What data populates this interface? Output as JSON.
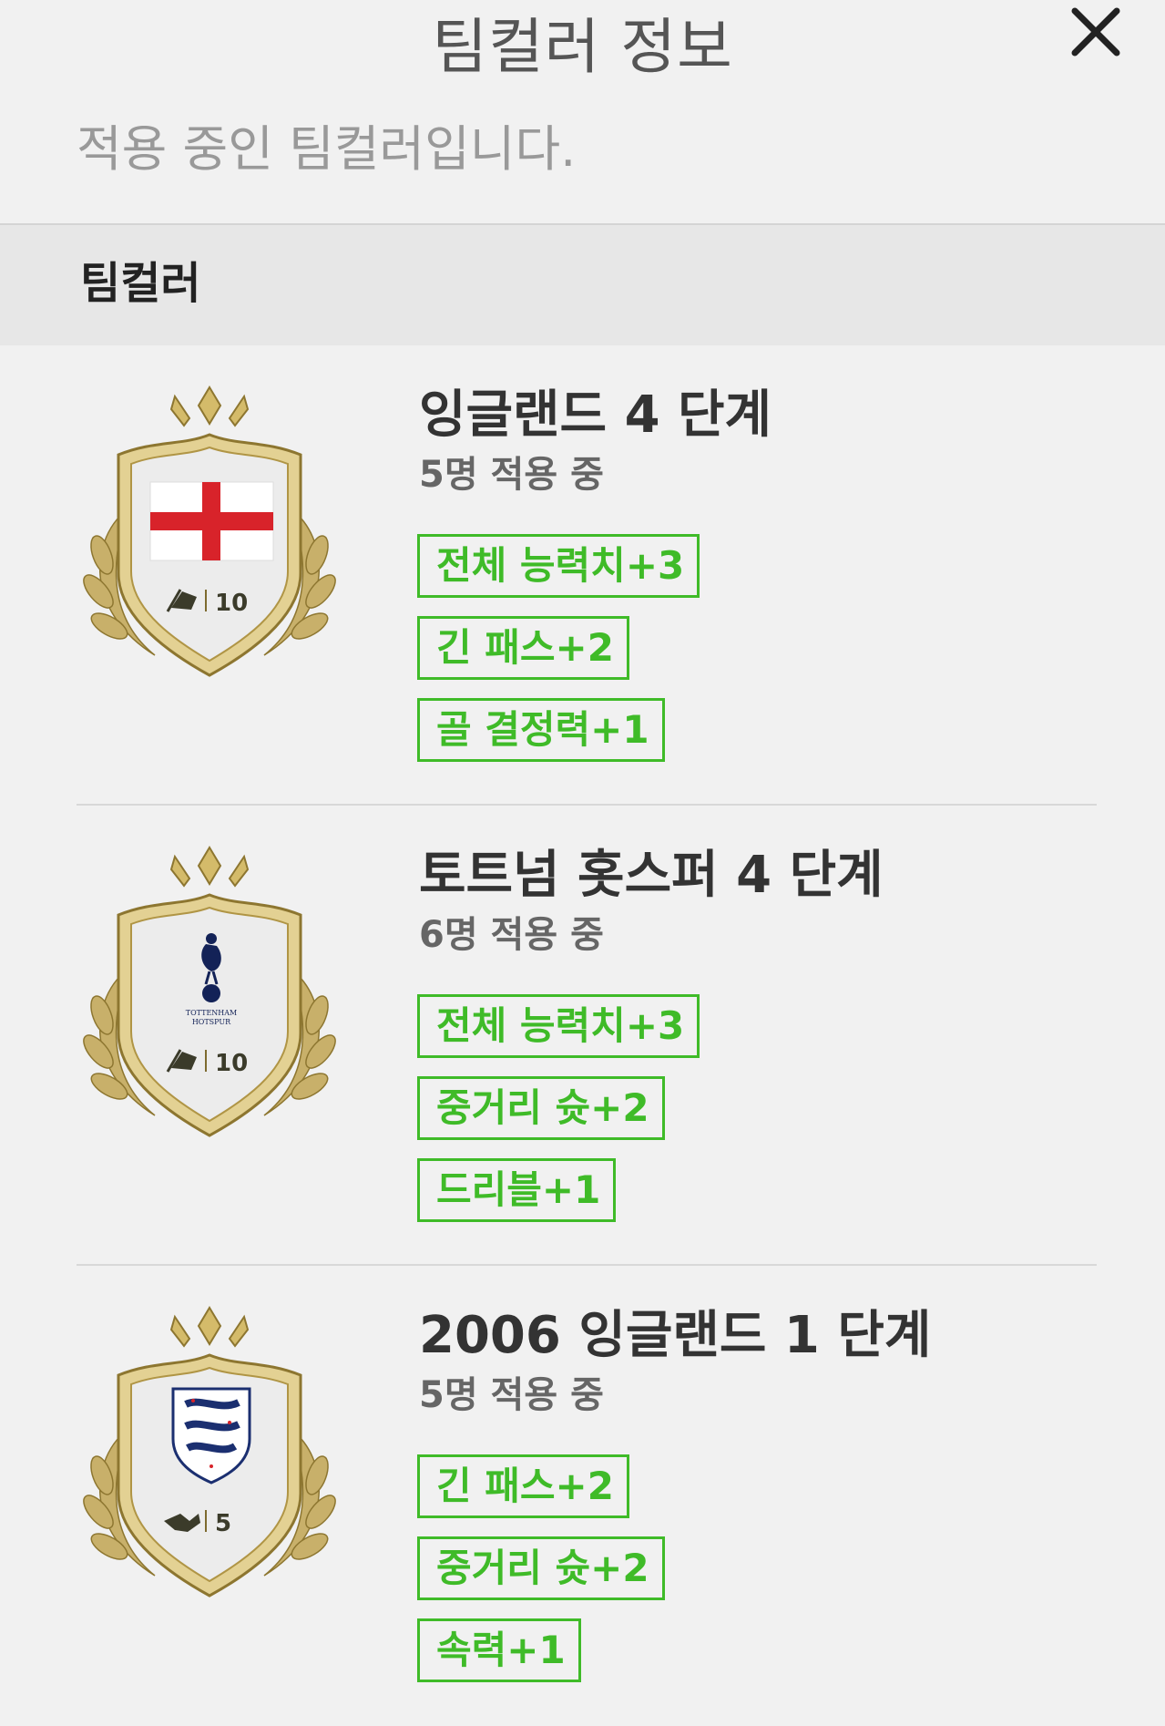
{
  "header": {
    "title": "팀컬러 정보",
    "subtitle": "적용 중인 팀컬러입니다.",
    "close_icon": "close-icon"
  },
  "section": {
    "label": "팀컬러"
  },
  "colors": {
    "accent": "#3fbb28",
    "gold": "#c2a552"
  },
  "team_colors": [
    {
      "name": "잉글랜드 4 단계",
      "applied": "5명 적용 중",
      "badge_type": "flag-icon",
      "badge_number": "10",
      "bonuses": [
        "전체 능력치+3",
        "긴 패스+2",
        "골 결정력+1"
      ]
    },
    {
      "name": "토트넘 홋스퍼 4 단계",
      "applied": "6명 적용 중",
      "badge_type": "flag-icon",
      "badge_number": "10",
      "badge_text": [
        "TOTTENHAM",
        "HOTSPUR"
      ],
      "bonuses": [
        "전체 능력치+3",
        "중거리 슛+2",
        "드리블+1"
      ]
    },
    {
      "name": "2006 잉글랜드 1 단계",
      "applied": "5명 적용 중",
      "badge_type": "handshake-icon",
      "badge_number": "5",
      "bonuses": [
        "긴 패스+2",
        "중거리 슛+2",
        "속력+1"
      ]
    }
  ]
}
